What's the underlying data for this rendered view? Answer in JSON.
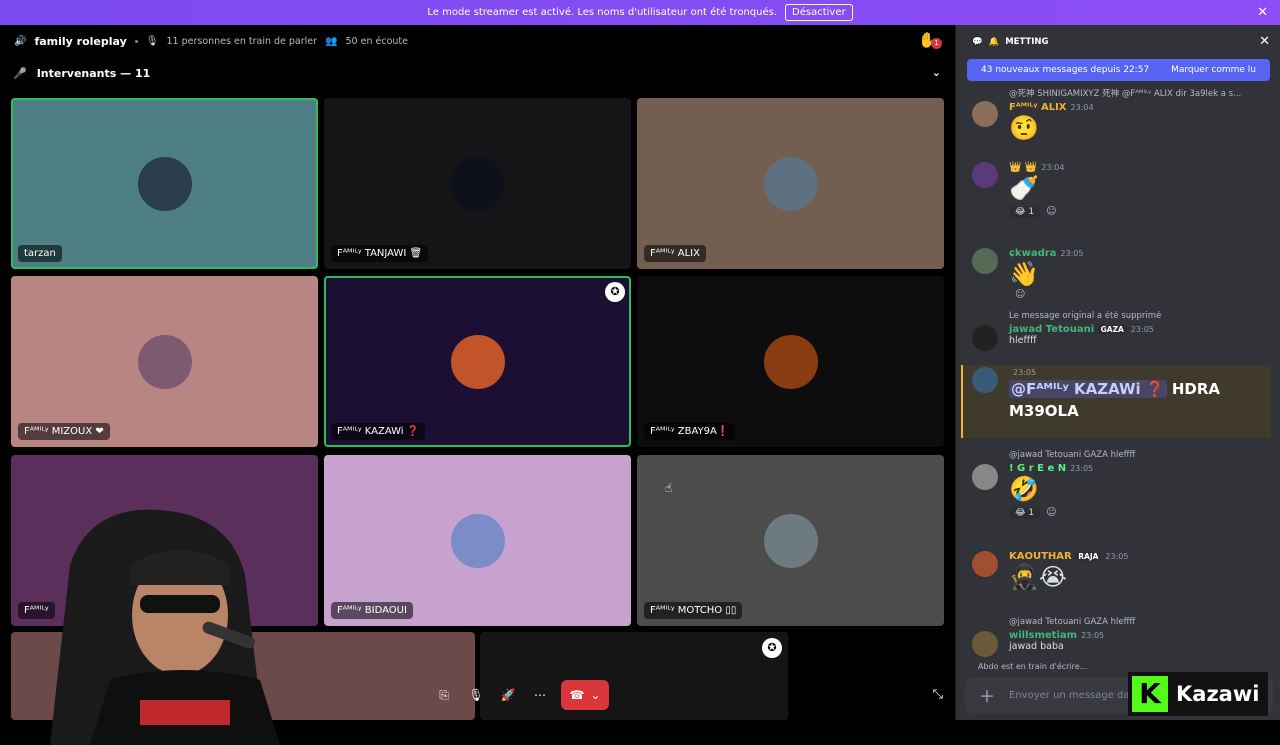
{
  "banner": {
    "text": "Le mode streamer est activé. Les noms d'utilisateur ont été tronqués.",
    "button": "Désactiver"
  },
  "voice": {
    "channel": "family roleplay",
    "talking": "11 personnes en train de parler",
    "listening": "50 en écoute",
    "hand_count": "1",
    "speakers_header": "Intervenants — 11"
  },
  "tiles": [
    {
      "name": "tarzan",
      "bg": "#4d7f84",
      "avatar_color": "#2a3d4a",
      "active": true
    },
    {
      "name": "Fᴬᴹᴵᴸʸ TANJAWI 🗑",
      "bg": "#151518",
      "avatar_color": "#0d0f1a",
      "active": false
    },
    {
      "name": "Fᴬᴹᴵᴸʸ ALIX",
      "bg": "#725f51",
      "avatar_color": "#5d7180",
      "active": false
    },
    {
      "name": "Fᴬᴹᴵᴸʸ MIZOUX ❤",
      "bg": "#b98583",
      "avatar_color": "#7d5a70",
      "active": false
    },
    {
      "name": "Fᴬᴹᴵᴸʸ KAZAWi ❓",
      "bg": "#1b0f33",
      "avatar_color": "#c3542a",
      "active": true
    },
    {
      "name": "Fᴬᴹᴵᴸʸ ZBAY9A❗",
      "bg": "#0d0d0d",
      "avatar_color": "#8a3d12",
      "active": false
    },
    {
      "name": "Fᴬᴹᴵᴸʸ",
      "bg": "#5a2f5c",
      "avatar_color": "#3e2a40",
      "active": false
    },
    {
      "name": "Fᴬᴹᴵᴸʸ BIDAOUI",
      "bg": "#c7a2cf",
      "avatar_color": "#7c8cc7",
      "active": false
    },
    {
      "name": "Fᴬᴹᴵᴸʸ MOTCHO ▯▯",
      "bg": "#4c4c4c",
      "avatar_color": "#6d7a82",
      "active": false
    }
  ],
  "chat": {
    "title": "METTING",
    "new_messages": "43 nouveaux messages depuis 22:57",
    "mark_read": "Marquer comme lu",
    "messages": [
      {
        "reply": "@死神 SHINIGAMIXYZ 死神 @Fᴬᴹᴵᴸʸ ALIX dir 3a9lek a s...",
        "user": "Fᴬᴹᴵᴸʸ ALIX",
        "user_color": "#f0b232",
        "time": "23:04",
        "content": "🤨"
      },
      {
        "user": "👑 👑",
        "user_color": "#f0b232",
        "time": "23:04",
        "content": "🍼",
        "reaction": "😂 1"
      },
      {
        "user": "ɕkwadra",
        "user_color": "#43b581",
        "time": "23:05",
        "content": "👋",
        "reaction": ""
      },
      {
        "reply": "Le message original a été supprimé",
        "user": "jawad Tetouani",
        "user_color": "#43b581",
        "tag": "GAZA",
        "time": "23:05",
        "content": "hleffff"
      },
      {
        "time": "23:05",
        "mention": "@Fᴬᴹᴵᴸʸ KAZAWi ❓",
        "content": "HDRA M39OLA"
      },
      {
        "reply": "@jawad Tetouani GAZA hleffff",
        "user": "! G r E e N",
        "user_color": "#57f287",
        "time": "23:05",
        "content": "🤣",
        "reaction": "😂 1"
      },
      {
        "user": "KAOUTHAR",
        "user_color": "#f0b232",
        "tag": "RAJA",
        "time": "23:05",
        "content": "🥷😭"
      },
      {
        "reply": "@jawad Tetouani GAZA hleffff",
        "user": "willsmetiam",
        "user_color": "#43b581",
        "time": "23:05",
        "content": "jawad baba"
      }
    ],
    "typing": "Abdo est en train d'écrire...",
    "input_placeholder": "Envoyer un message dans"
  },
  "watermark": "Kazawi"
}
